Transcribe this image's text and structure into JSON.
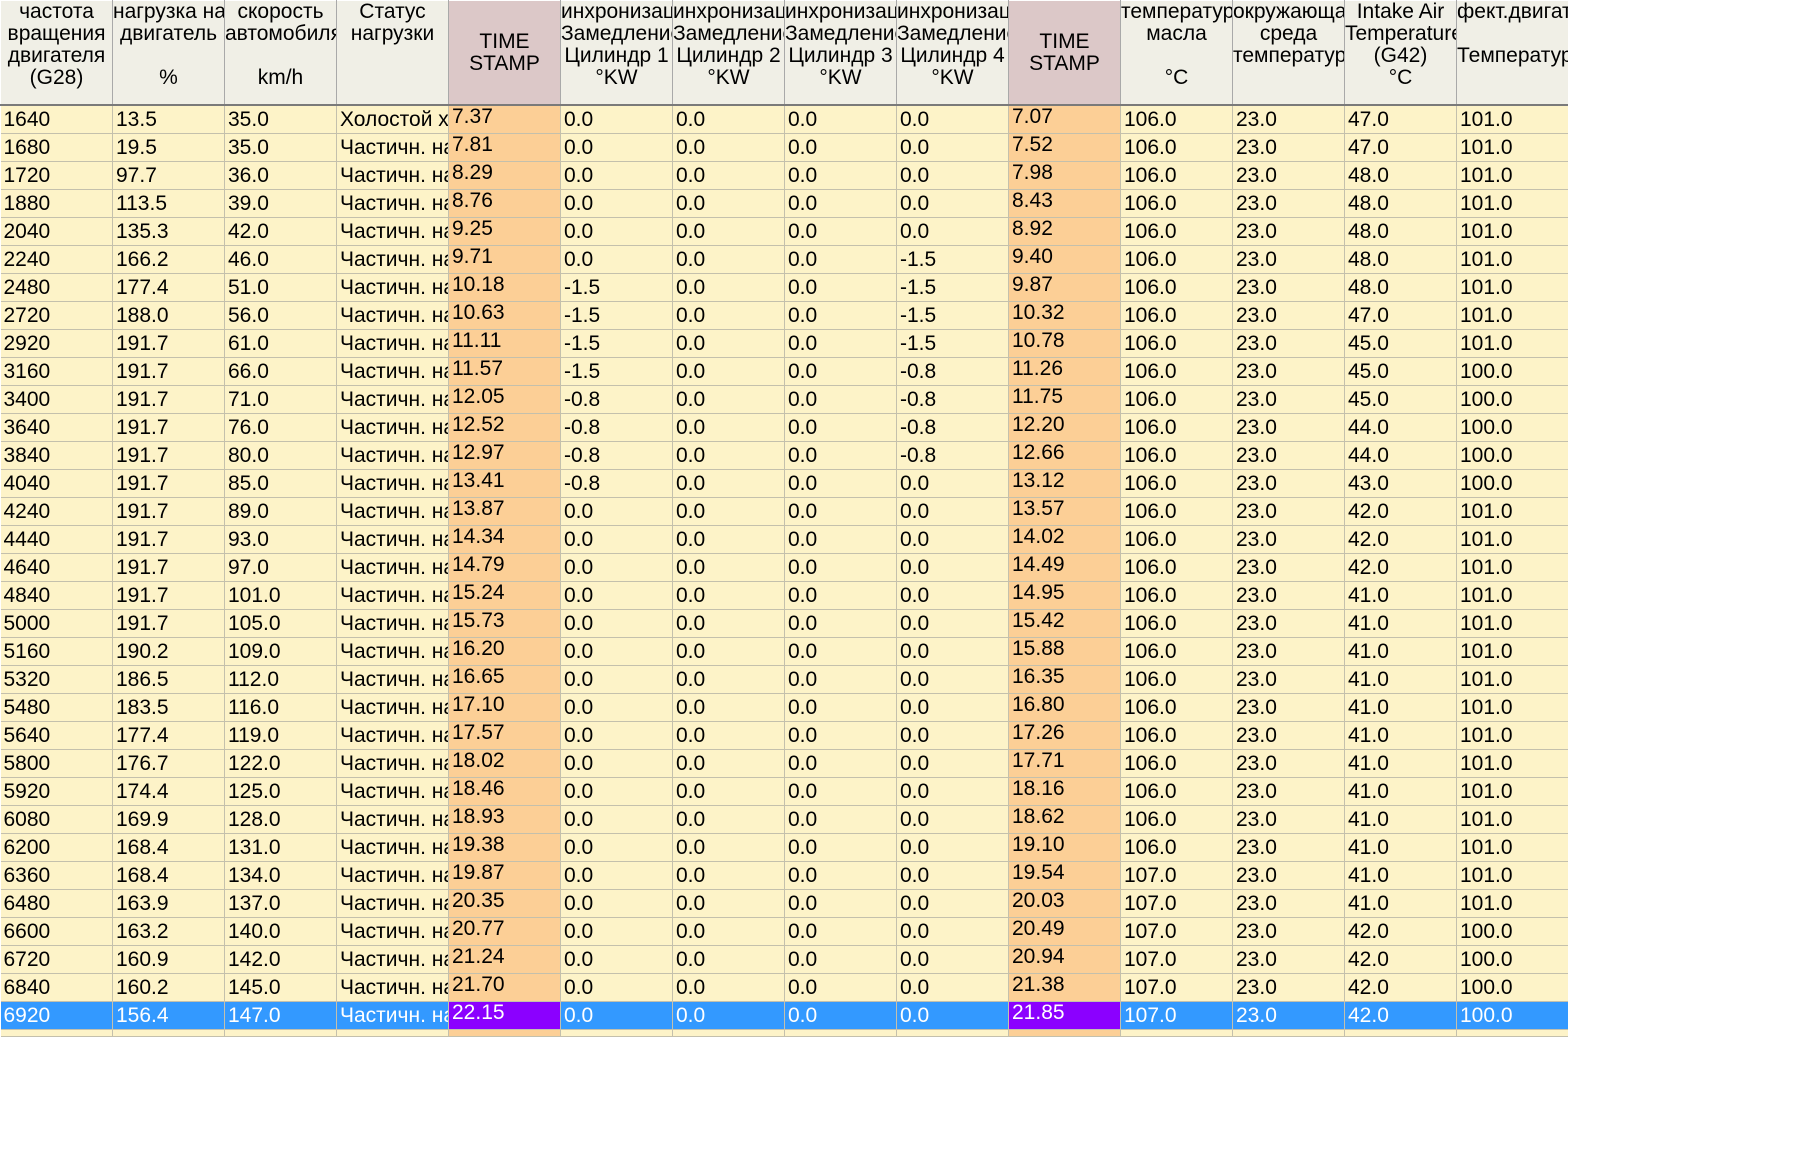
{
  "columns": [
    {
      "lines": [
        "частота",
        "вращения",
        "двигателя",
        "(G28)"
      ],
      "ts": false
    },
    {
      "lines": [
        "нагрузка на",
        "двигатель",
        "",
        "%"
      ],
      "ts": false
    },
    {
      "lines": [
        "скорость",
        "автомобиля",
        "",
        "km/h"
      ],
      "ts": false
    },
    {
      "lines": [
        "Статус",
        "нагрузки",
        "",
        ""
      ],
      "ts": false
    },
    {
      "lines": [
        "TIME",
        "STAMP"
      ],
      "ts": true
    },
    {
      "lines": [
        "инхронизаци",
        "Замедление",
        "Цилиндр 1",
        "°KW"
      ],
      "ts": false
    },
    {
      "lines": [
        "инхронизаци",
        "Замедление",
        "Цилиндр 2",
        "°KW"
      ],
      "ts": false
    },
    {
      "lines": [
        "инхронизаци",
        "Замедление",
        "Цилиндр 3",
        "°KW"
      ],
      "ts": false
    },
    {
      "lines": [
        "инхронизаци",
        "Замедление",
        "Цилиндр 4",
        "°KW"
      ],
      "ts": false
    },
    {
      "lines": [
        "TIME",
        "STAMP"
      ],
      "ts": true
    },
    {
      "lines": [
        "температура",
        "масла",
        "",
        "°C"
      ],
      "ts": false
    },
    {
      "lines": [
        "окружающая",
        "среда",
        "температура",
        ""
      ],
      "ts": false
    },
    {
      "lines": [
        "Intake Air",
        "Temperature",
        "(G42)",
        "°C"
      ],
      "ts": false
    },
    {
      "lines": [
        "фект.двигат",
        "",
        "Температура",
        ""
      ],
      "ts": false
    }
  ],
  "rows": [
    [
      "1640",
      "13.5",
      "35.0",
      "Холостой хс",
      "7.37",
      "0.0",
      "0.0",
      "0.0",
      "0.0",
      "7.07",
      "106.0",
      "23.0",
      "47.0",
      "101.0"
    ],
    [
      "1680",
      "19.5",
      "35.0",
      "Частичн. на",
      "7.81",
      "0.0",
      "0.0",
      "0.0",
      "0.0",
      "7.52",
      "106.0",
      "23.0",
      "47.0",
      "101.0"
    ],
    [
      "1720",
      "97.7",
      "36.0",
      "Частичн. на",
      "8.29",
      "0.0",
      "0.0",
      "0.0",
      "0.0",
      "7.98",
      "106.0",
      "23.0",
      "48.0",
      "101.0"
    ],
    [
      "1880",
      "113.5",
      "39.0",
      "Частичн. на",
      "8.76",
      "0.0",
      "0.0",
      "0.0",
      "0.0",
      "8.43",
      "106.0",
      "23.0",
      "48.0",
      "101.0"
    ],
    [
      "2040",
      "135.3",
      "42.0",
      "Частичн. на",
      "9.25",
      "0.0",
      "0.0",
      "0.0",
      "0.0",
      "8.92",
      "106.0",
      "23.0",
      "48.0",
      "101.0"
    ],
    [
      "2240",
      "166.2",
      "46.0",
      "Частичн. на",
      "9.71",
      "0.0",
      "0.0",
      "0.0",
      "-1.5",
      "9.40",
      "106.0",
      "23.0",
      "48.0",
      "101.0"
    ],
    [
      "2480",
      "177.4",
      "51.0",
      "Частичн. на",
      "10.18",
      "-1.5",
      "0.0",
      "0.0",
      "-1.5",
      "9.87",
      "106.0",
      "23.0",
      "48.0",
      "101.0"
    ],
    [
      "2720",
      "188.0",
      "56.0",
      "Частичн. на",
      "10.63",
      "-1.5",
      "0.0",
      "0.0",
      "-1.5",
      "10.32",
      "106.0",
      "23.0",
      "47.0",
      "101.0"
    ],
    [
      "2920",
      "191.7",
      "61.0",
      "Частичн. на",
      "11.11",
      "-1.5",
      "0.0",
      "0.0",
      "-1.5",
      "10.78",
      "106.0",
      "23.0",
      "45.0",
      "101.0"
    ],
    [
      "3160",
      "191.7",
      "66.0",
      "Частичн. на",
      "11.57",
      "-1.5",
      "0.0",
      "0.0",
      "-0.8",
      "11.26",
      "106.0",
      "23.0",
      "45.0",
      "100.0"
    ],
    [
      "3400",
      "191.7",
      "71.0",
      "Частичн. на",
      "12.05",
      "-0.8",
      "0.0",
      "0.0",
      "-0.8",
      "11.75",
      "106.0",
      "23.0",
      "45.0",
      "100.0"
    ],
    [
      "3640",
      "191.7",
      "76.0",
      "Частичн. на",
      "12.52",
      "-0.8",
      "0.0",
      "0.0",
      "-0.8",
      "12.20",
      "106.0",
      "23.0",
      "44.0",
      "100.0"
    ],
    [
      "3840",
      "191.7",
      "80.0",
      "Частичн. на",
      "12.97",
      "-0.8",
      "0.0",
      "0.0",
      "-0.8",
      "12.66",
      "106.0",
      "23.0",
      "44.0",
      "100.0"
    ],
    [
      "4040",
      "191.7",
      "85.0",
      "Частичн. на",
      "13.41",
      "-0.8",
      "0.0",
      "0.0",
      "0.0",
      "13.12",
      "106.0",
      "23.0",
      "43.0",
      "100.0"
    ],
    [
      "4240",
      "191.7",
      "89.0",
      "Частичн. на",
      "13.87",
      "0.0",
      "0.0",
      "0.0",
      "0.0",
      "13.57",
      "106.0",
      "23.0",
      "42.0",
      "101.0"
    ],
    [
      "4440",
      "191.7",
      "93.0",
      "Частичн. на",
      "14.34",
      "0.0",
      "0.0",
      "0.0",
      "0.0",
      "14.02",
      "106.0",
      "23.0",
      "42.0",
      "101.0"
    ],
    [
      "4640",
      "191.7",
      "97.0",
      "Частичн. на",
      "14.79",
      "0.0",
      "0.0",
      "0.0",
      "0.0",
      "14.49",
      "106.0",
      "23.0",
      "42.0",
      "101.0"
    ],
    [
      "4840",
      "191.7",
      "101.0",
      "Частичн. на",
      "15.24",
      "0.0",
      "0.0",
      "0.0",
      "0.0",
      "14.95",
      "106.0",
      "23.0",
      "41.0",
      "101.0"
    ],
    [
      "5000",
      "191.7",
      "105.0",
      "Частичн. на",
      "15.73",
      "0.0",
      "0.0",
      "0.0",
      "0.0",
      "15.42",
      "106.0",
      "23.0",
      "41.0",
      "101.0"
    ],
    [
      "5160",
      "190.2",
      "109.0",
      "Частичн. на",
      "16.20",
      "0.0",
      "0.0",
      "0.0",
      "0.0",
      "15.88",
      "106.0",
      "23.0",
      "41.0",
      "101.0"
    ],
    [
      "5320",
      "186.5",
      "112.0",
      "Частичн. на",
      "16.65",
      "0.0",
      "0.0",
      "0.0",
      "0.0",
      "16.35",
      "106.0",
      "23.0",
      "41.0",
      "101.0"
    ],
    [
      "5480",
      "183.5",
      "116.0",
      "Частичн. на",
      "17.10",
      "0.0",
      "0.0",
      "0.0",
      "0.0",
      "16.80",
      "106.0",
      "23.0",
      "41.0",
      "101.0"
    ],
    [
      "5640",
      "177.4",
      "119.0",
      "Частичн. на",
      "17.57",
      "0.0",
      "0.0",
      "0.0",
      "0.0",
      "17.26",
      "106.0",
      "23.0",
      "41.0",
      "101.0"
    ],
    [
      "5800",
      "176.7",
      "122.0",
      "Частичн. на",
      "18.02",
      "0.0",
      "0.0",
      "0.0",
      "0.0",
      "17.71",
      "106.0",
      "23.0",
      "41.0",
      "101.0"
    ],
    [
      "5920",
      "174.4",
      "125.0",
      "Частичн. на",
      "18.46",
      "0.0",
      "0.0",
      "0.0",
      "0.0",
      "18.16",
      "106.0",
      "23.0",
      "41.0",
      "101.0"
    ],
    [
      "6080",
      "169.9",
      "128.0",
      "Частичн. на",
      "18.93",
      "0.0",
      "0.0",
      "0.0",
      "0.0",
      "18.62",
      "106.0",
      "23.0",
      "41.0",
      "101.0"
    ],
    [
      "6200",
      "168.4",
      "131.0",
      "Частичн. на",
      "19.38",
      "0.0",
      "0.0",
      "0.0",
      "0.0",
      "19.10",
      "106.0",
      "23.0",
      "41.0",
      "101.0"
    ],
    [
      "6360",
      "168.4",
      "134.0",
      "Частичн. на",
      "19.87",
      "0.0",
      "0.0",
      "0.0",
      "0.0",
      "19.54",
      "107.0",
      "23.0",
      "41.0",
      "101.0"
    ],
    [
      "6480",
      "163.9",
      "137.0",
      "Частичн. на",
      "20.35",
      "0.0",
      "0.0",
      "0.0",
      "0.0",
      "20.03",
      "107.0",
      "23.0",
      "41.0",
      "101.0"
    ],
    [
      "6600",
      "163.2",
      "140.0",
      "Частичн. на",
      "20.77",
      "0.0",
      "0.0",
      "0.0",
      "0.0",
      "20.49",
      "107.0",
      "23.0",
      "42.0",
      "100.0"
    ],
    [
      "6720",
      "160.9",
      "142.0",
      "Частичн. на",
      "21.24",
      "0.0",
      "0.0",
      "0.0",
      "0.0",
      "20.94",
      "107.0",
      "23.0",
      "42.0",
      "100.0"
    ],
    [
      "6840",
      "160.2",
      "145.0",
      "Частичн. на",
      "21.70",
      "0.0",
      "0.0",
      "0.0",
      "0.0",
      "21.38",
      "107.0",
      "23.0",
      "42.0",
      "100.0"
    ],
    [
      "6920",
      "156.4",
      "147.0",
      "Частичн. на",
      "22.15",
      "0.0",
      "0.0",
      "0.0",
      "0.0",
      "21.85",
      "107.0",
      "23.0",
      "42.0",
      "100.0"
    ]
  ],
  "selected_row_index": 32,
  "colors": {
    "header_bg": "#f0efe6",
    "timestamp_header_bg": "#dcc8c8",
    "cell_bg": "#fdf3c8",
    "timestamp_cell_bg": "#fccf96",
    "selected_row_bg": "#3399ff",
    "selected_timestamp_bg": "#8b00ff"
  }
}
